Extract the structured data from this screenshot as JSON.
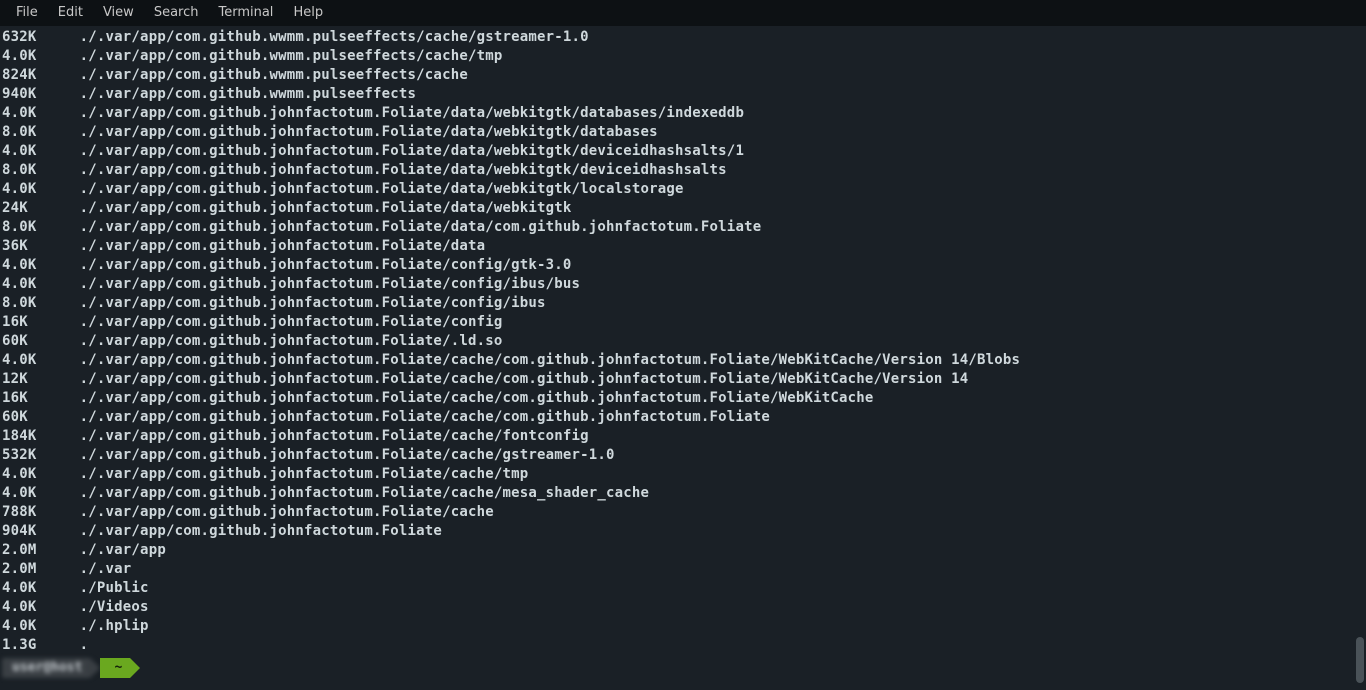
{
  "menubar": {
    "items": [
      "File",
      "Edit",
      "View",
      "Search",
      "Terminal",
      "Help"
    ]
  },
  "terminal": {
    "size_col_width": 8,
    "lines": [
      {
        "size": "632K",
        "path": "./.var/app/com.github.wwmm.pulseeffects/cache/gstreamer-1.0"
      },
      {
        "size": "4.0K",
        "path": "./.var/app/com.github.wwmm.pulseeffects/cache/tmp"
      },
      {
        "size": "824K",
        "path": "./.var/app/com.github.wwmm.pulseeffects/cache"
      },
      {
        "size": "940K",
        "path": "./.var/app/com.github.wwmm.pulseeffects"
      },
      {
        "size": "4.0K",
        "path": "./.var/app/com.github.johnfactotum.Foliate/data/webkitgtk/databases/indexeddb"
      },
      {
        "size": "8.0K",
        "path": "./.var/app/com.github.johnfactotum.Foliate/data/webkitgtk/databases"
      },
      {
        "size": "4.0K",
        "path": "./.var/app/com.github.johnfactotum.Foliate/data/webkitgtk/deviceidhashsalts/1"
      },
      {
        "size": "8.0K",
        "path": "./.var/app/com.github.johnfactotum.Foliate/data/webkitgtk/deviceidhashsalts"
      },
      {
        "size": "4.0K",
        "path": "./.var/app/com.github.johnfactotum.Foliate/data/webkitgtk/localstorage"
      },
      {
        "size": "24K",
        "path": "./.var/app/com.github.johnfactotum.Foliate/data/webkitgtk"
      },
      {
        "size": "8.0K",
        "path": "./.var/app/com.github.johnfactotum.Foliate/data/com.github.johnfactotum.Foliate"
      },
      {
        "size": "36K",
        "path": "./.var/app/com.github.johnfactotum.Foliate/data"
      },
      {
        "size": "4.0K",
        "path": "./.var/app/com.github.johnfactotum.Foliate/config/gtk-3.0"
      },
      {
        "size": "4.0K",
        "path": "./.var/app/com.github.johnfactotum.Foliate/config/ibus/bus"
      },
      {
        "size": "8.0K",
        "path": "./.var/app/com.github.johnfactotum.Foliate/config/ibus"
      },
      {
        "size": "16K",
        "path": "./.var/app/com.github.johnfactotum.Foliate/config"
      },
      {
        "size": "60K",
        "path": "./.var/app/com.github.johnfactotum.Foliate/.ld.so"
      },
      {
        "size": "4.0K",
        "path": "./.var/app/com.github.johnfactotum.Foliate/cache/com.github.johnfactotum.Foliate/WebKitCache/Version 14/Blobs"
      },
      {
        "size": "12K",
        "path": "./.var/app/com.github.johnfactotum.Foliate/cache/com.github.johnfactotum.Foliate/WebKitCache/Version 14"
      },
      {
        "size": "16K",
        "path": "./.var/app/com.github.johnfactotum.Foliate/cache/com.github.johnfactotum.Foliate/WebKitCache"
      },
      {
        "size": "60K",
        "path": "./.var/app/com.github.johnfactotum.Foliate/cache/com.github.johnfactotum.Foliate"
      },
      {
        "size": "184K",
        "path": "./.var/app/com.github.johnfactotum.Foliate/cache/fontconfig"
      },
      {
        "size": "532K",
        "path": "./.var/app/com.github.johnfactotum.Foliate/cache/gstreamer-1.0"
      },
      {
        "size": "4.0K",
        "path": "./.var/app/com.github.johnfactotum.Foliate/cache/tmp"
      },
      {
        "size": "4.0K",
        "path": "./.var/app/com.github.johnfactotum.Foliate/cache/mesa_shader_cache"
      },
      {
        "size": "788K",
        "path": "./.var/app/com.github.johnfactotum.Foliate/cache"
      },
      {
        "size": "904K",
        "path": "./.var/app/com.github.johnfactotum.Foliate"
      },
      {
        "size": "2.0M",
        "path": "./.var/app"
      },
      {
        "size": "2.0M",
        "path": "./.var"
      },
      {
        "size": "4.0K",
        "path": "./Public"
      },
      {
        "size": "4.0K",
        "path": "./Videos"
      },
      {
        "size": "4.0K",
        "path": "./.hplip"
      },
      {
        "size": "1.3G",
        "path": "."
      }
    ],
    "prompt": {
      "user_host": "user@host",
      "cwd": "~"
    }
  },
  "scrollbar": {
    "thumb_top_pct": 92,
    "thumb_height_pct": 7
  }
}
